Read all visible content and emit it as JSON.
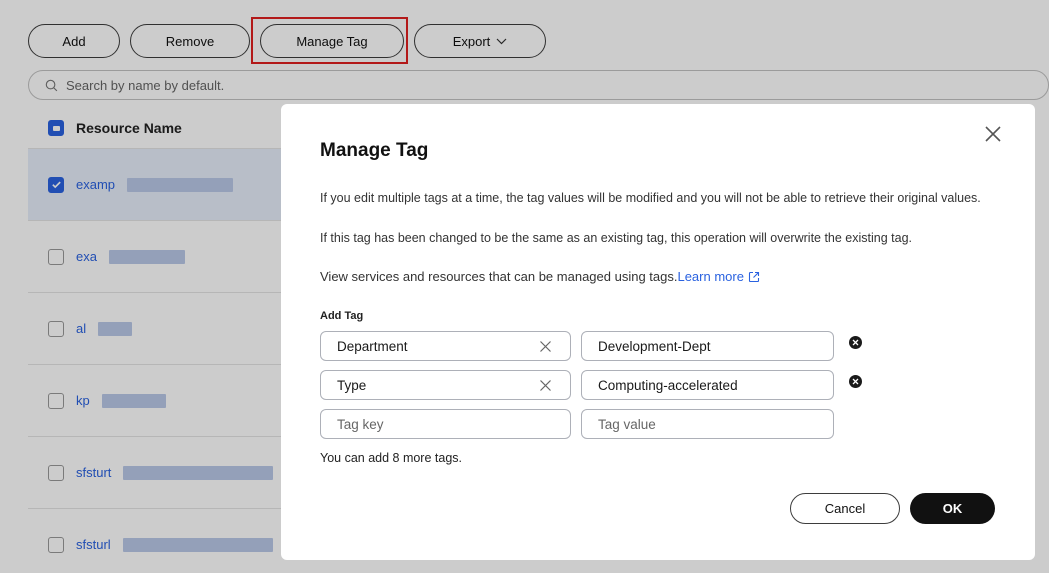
{
  "toolbar": {
    "add_label": "Add",
    "remove_label": "Remove",
    "manage_tag_label": "Manage Tag",
    "export_label": "Export"
  },
  "search": {
    "placeholder": "Search by name by default."
  },
  "table": {
    "header": "Resource Name",
    "rows": [
      {
        "name": "examp",
        "checked": true
      },
      {
        "name": "exa",
        "checked": false
      },
      {
        "name": "al",
        "checked": false
      },
      {
        "name": "kp",
        "checked": false
      },
      {
        "name": "sfsturt",
        "checked": false
      },
      {
        "name": "sfsturl",
        "checked": false
      }
    ]
  },
  "modal": {
    "title": "Manage Tag",
    "para1": "If you edit multiple tags at a time, the tag values will be modified and you will not be able to retrieve their original values.",
    "para2": "If this tag has been changed to be the same as an existing tag, this operation will overwrite the existing tag.",
    "para3": "View services and resources that can be managed using tags.",
    "learn_more": "Learn more",
    "add_tag_label": "Add Tag",
    "tags": [
      {
        "key": "Department",
        "value": "Development-Dept"
      },
      {
        "key": "Type",
        "value": "Computing-accelerated"
      }
    ],
    "key_placeholder": "Tag key",
    "value_placeholder": "Tag value",
    "hint": "You can add 8 more tags.",
    "cancel_label": "Cancel",
    "ok_label": "OK"
  },
  "colors": {
    "accent": "#2a62e0",
    "highlight": "#e02020",
    "primary_button": "#111111"
  }
}
